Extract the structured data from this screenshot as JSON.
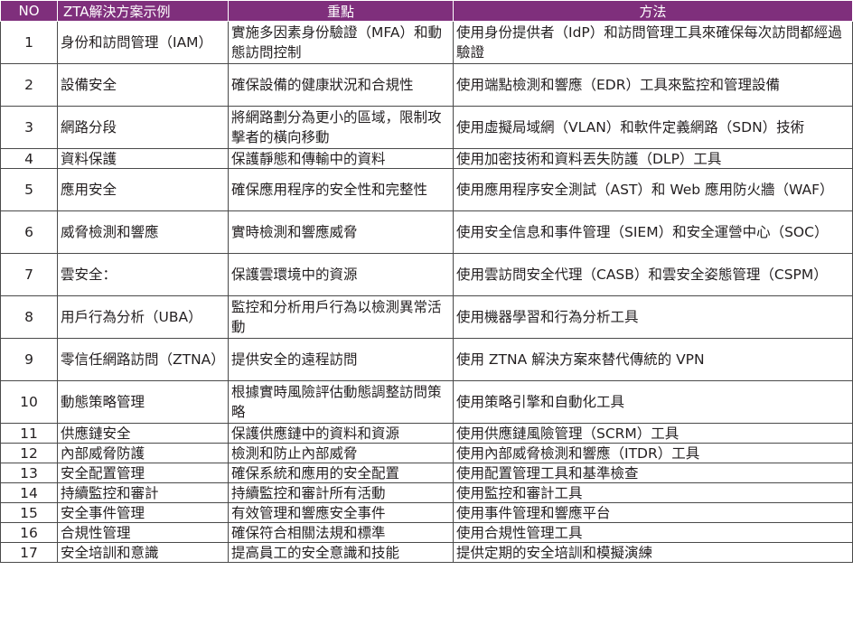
{
  "headers": {
    "no": "NO",
    "case": "ZTA解決方案示例",
    "focus": "重點",
    "method": "方法"
  },
  "rows": [
    {
      "no": "1",
      "case": "身份和訪問管理（IAM）",
      "focus": "實施多因素身份驗證（MFA）和動態訪問控制",
      "method": "使用身份提供者（IdP）和訪問管理工具來確保每次訪問都經過驗證"
    },
    {
      "no": "2",
      "case": "設備安全",
      "focus": "確保設備的健康狀況和合規性",
      "method": "使用端點檢測和響應（EDR）工具來監控和管理設備"
    },
    {
      "no": "3",
      "case": "網路分段",
      "focus": "將網路劃分為更小的區域，限制攻擊者的橫向移動",
      "method": "使用虛擬局域網（VLAN）和軟件定義網路（SDN）技術"
    },
    {
      "no": "4",
      "case": "資料保護",
      "focus": "保護靜態和傳輸中的資料",
      "method": "使用加密技術和資料丟失防護（DLP）工具"
    },
    {
      "no": "5",
      "case": "應用安全",
      "focus": "確保應用程序的安全性和完整性",
      "method": "使用應用程序安全測試（AST）和 Web 應用防火牆（WAF）"
    },
    {
      "no": "6",
      "case": "威脅檢測和響應",
      "focus": "實時檢測和響應威脅",
      "method": "使用安全信息和事件管理（SIEM）和安全運營中心（SOC）"
    },
    {
      "no": "7",
      "case": "雲安全：",
      "focus": "保護雲環境中的資源",
      "method": "使用雲訪問安全代理（CASB）和雲安全姿態管理（CSPM）"
    },
    {
      "no": "8",
      "case": "用戶行為分析（UBA）",
      "focus": "監控和分析用戶行為以檢測異常活動",
      "method": "使用機器學習和行為分析工具"
    },
    {
      "no": "9",
      "case": "零信任網路訪問（ZTNA）",
      "focus": "提供安全的遠程訪問",
      "method": "使用 ZTNA 解決方案來替代傳統的 VPN"
    },
    {
      "no": "10",
      "case": "動態策略管理",
      "focus": "根據實時風險評估動態調整訪問策略",
      "method": "使用策略引擎和自動化工具"
    },
    {
      "no": "11",
      "case": "供應鏈安全",
      "focus": "保護供應鏈中的資料和資源",
      "method": "使用供應鏈風險管理（SCRM）工具"
    },
    {
      "no": "12",
      "case": "內部威脅防護",
      "focus": "檢測和防止內部威脅",
      "method": "使用內部威脅檢測和響應（ITDR）工具"
    },
    {
      "no": "13",
      "case": "安全配置管理",
      "focus": "確保系統和應用的安全配置",
      "method": "使用配置管理工具和基準檢查"
    },
    {
      "no": "14",
      "case": "持續監控和審計",
      "focus": "持續監控和審計所有活動",
      "method": "使用監控和審計工具"
    },
    {
      "no": "15",
      "case": "安全事件管理",
      "focus": "有效管理和響應安全事件",
      "method": "使用事件管理和響應平台"
    },
    {
      "no": "16",
      "case": "合規性管理",
      "focus": "確保符合相關法規和標準",
      "method": "使用合規性管理工具"
    },
    {
      "no": "17",
      "case": "安全培訓和意識",
      "focus": "提高員工的安全意識和技能",
      "method": "提供定期的安全培訓和模擬演練"
    }
  ]
}
